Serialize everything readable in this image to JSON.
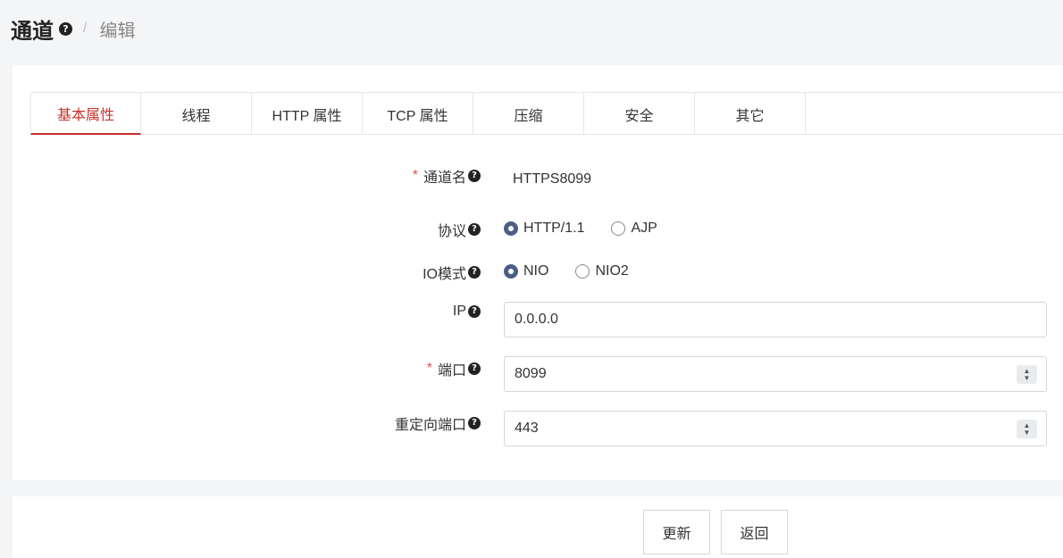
{
  "header": {
    "title": "通道",
    "separator": "/",
    "subtitle": "编辑"
  },
  "tabs": [
    {
      "label": "基本属性",
      "active": true
    },
    {
      "label": "线程"
    },
    {
      "label": "HTTP 属性"
    },
    {
      "label": "TCP 属性"
    },
    {
      "label": "压缩"
    },
    {
      "label": "安全"
    },
    {
      "label": "其它"
    }
  ],
  "form": {
    "required_mark": "*",
    "name": {
      "label": "通道名",
      "value": "HTTPS8099"
    },
    "protocol": {
      "label": "协议",
      "options": [
        "HTTP/1.1",
        "AJP"
      ],
      "selected": "HTTP/1.1"
    },
    "io_mode": {
      "label": "IO模式",
      "options": [
        "NIO",
        "NIO2"
      ],
      "selected": "NIO"
    },
    "ip": {
      "label": "IP",
      "value": "0.0.0.0"
    },
    "port": {
      "label": "端口",
      "value": "8099"
    },
    "redirect_port": {
      "label": "重定向端口",
      "value": "443"
    }
  },
  "icons": {
    "help": "question-circle-icon",
    "stepper": "up-down-stepper-icon"
  },
  "colors": {
    "active_tab": "#c9302c",
    "radio_checked": "#4a5f86",
    "required": "#d9534f"
  },
  "buttons": {
    "update": "更新",
    "back": "返回"
  }
}
